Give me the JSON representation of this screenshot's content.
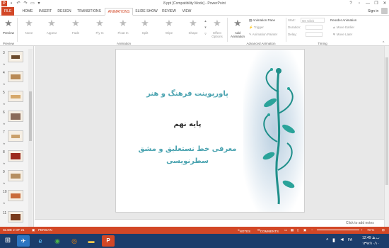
{
  "window": {
    "title": "8.ppt [Compatibility Mode] - PowerPoint",
    "help": "?",
    "minimize": "—",
    "restore": "❐",
    "close": "✕",
    "sign_in": "Sign in"
  },
  "tabs": [
    "FILE",
    "HOME",
    "INSERT",
    "DESIGN",
    "TRANSITIONS",
    "ANIMATIONS",
    "SLIDE SHOW",
    "REVIEW",
    "VIEW"
  ],
  "active_tab": "ANIMATIONS",
  "ribbon": {
    "preview_label": "Preview",
    "preview_group": "Preview",
    "animations": [
      "None",
      "Appear",
      "Fade",
      "Fly In",
      "Float In",
      "Split",
      "Wipe",
      "Shape"
    ],
    "effect_options": "Effect Options",
    "animation_group": "Animation",
    "add_animation": "Add Animation",
    "animation_pane": "Animation Pane",
    "trigger": "Trigger",
    "animation_painter": "Animation Painter",
    "advanced_group": "Advanced Animation",
    "start_label": "Start:",
    "start_value": "On Click",
    "duration_label": "Duration:",
    "delay_label": "Delay:",
    "timing_group": "Timing",
    "reorder_title": "Reorder Animation",
    "move_earlier": "Move Earlier",
    "move_later": "Move Later"
  },
  "slides_panel": {
    "numbers": [
      "3",
      "4",
      "5",
      "6",
      "7",
      "8",
      "9",
      "10",
      "11"
    ]
  },
  "slide": {
    "line1": "پاورپوینت فرهنگ و هنر",
    "line2": "پایه نهم",
    "line3": "معرفی خط نستعلیق و مشق",
    "line4": "سطرنویسی"
  },
  "notes": "Click to add notes",
  "status": {
    "slide_info": "SLIDE 2 OF 21",
    "language": "PERSIAN",
    "notes": "NOTES",
    "comments": "COMMENTS",
    "zoom": "70 %"
  },
  "taskbar": {
    "time": "12:49 ب.ظ",
    "date": "۱۳۹۷/۱۰/۱۰",
    "lang": "FA"
  },
  "colors": {
    "accent": "#d24726",
    "teal_text": "#4aa3b0",
    "dark_text": "#2f2f2f",
    "taskbar": "#1b3d6b"
  }
}
